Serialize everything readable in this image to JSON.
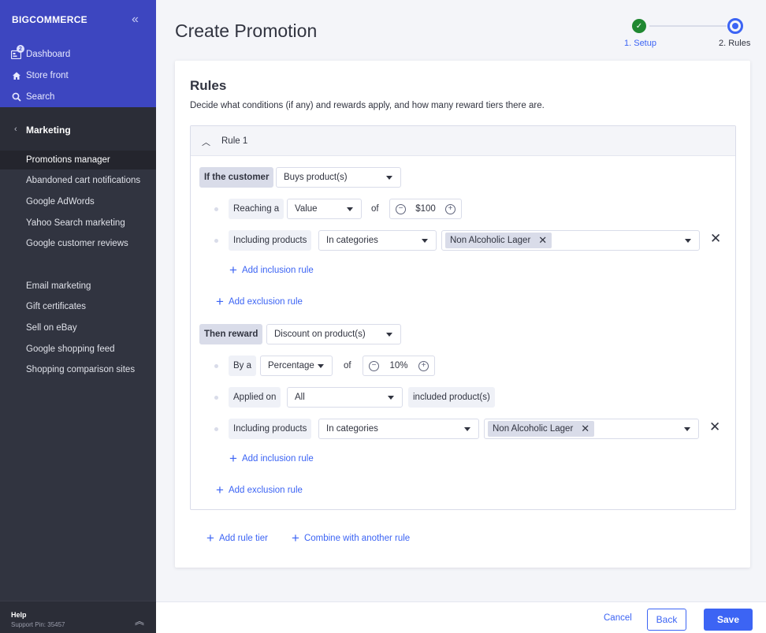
{
  "sidebar": {
    "logo": "BIGCOMMERCE",
    "top_links": [
      {
        "label": "Dashboard",
        "badge": "2"
      },
      {
        "label": "Store front"
      },
      {
        "label": "Search"
      }
    ],
    "section": "Marketing",
    "items": [
      "Promotions manager",
      "Abandoned cart notifications",
      "Google AdWords",
      "Yahoo Search marketing",
      "Google customer reviews",
      "Email marketing",
      "Gift certificates",
      "Sell on eBay",
      "Google shopping feed",
      "Shopping comparison sites"
    ],
    "footer": {
      "help": "Help",
      "pin": "Support Pin: 35457"
    }
  },
  "page": {
    "title": "Create Promotion",
    "steps": [
      {
        "label": "1. Setup",
        "done": true
      },
      {
        "label": "2. Rules",
        "current": true
      }
    ]
  },
  "rules": {
    "title": "Rules",
    "description": "Decide what conditions (if any) and rewards apply, and how many reward tiers there are.",
    "rule_label": "Rule 1",
    "condition": {
      "label": "If the customer",
      "select": "Buys product(s)",
      "reaching_label": "Reaching a",
      "reaching_select": "Value",
      "of": "of",
      "amount": "$100",
      "including_label": "Including products",
      "including_select": "In categories",
      "chip": "Non Alcoholic Lager",
      "add_inclusion": "Add inclusion rule",
      "add_exclusion": "Add exclusion rule"
    },
    "reward": {
      "label": "Then reward",
      "select": "Discount on product(s)",
      "by_label": "By a",
      "by_select": "Percentage",
      "of": "of",
      "amount": "10%",
      "applied_label": "Applied on",
      "applied_select": "All",
      "applied_suffix": "included product(s)",
      "including_label": "Including products",
      "including_select": "In categories",
      "chip": "Non Alcoholic Lager",
      "add_inclusion": "Add inclusion rule",
      "add_exclusion": "Add exclusion rule"
    },
    "add_rule_tier": "Add rule tier",
    "combine": "Combine with another rule"
  },
  "footer": {
    "cancel": "Cancel",
    "back": "Back",
    "save": "Save"
  },
  "colors": {
    "primary": "#3c64f4",
    "sidebar": "#313440",
    "sidebar_top": "#3d46c0",
    "success": "#208831"
  }
}
